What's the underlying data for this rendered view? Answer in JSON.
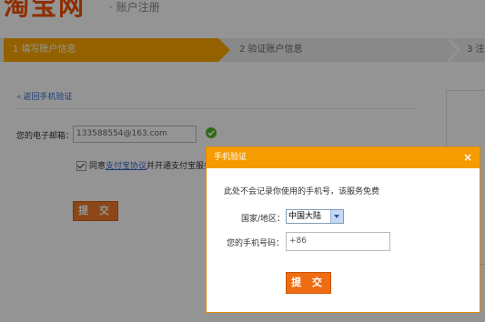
{
  "header": {
    "logo_text": "淘宝网",
    "subtitle": "· 账户注册"
  },
  "steps": [
    {
      "label": "1 填写账户信息",
      "active": true
    },
    {
      "label": "2 验证账户信息",
      "active": false
    },
    {
      "label": "3 注",
      "active": false
    }
  ],
  "form": {
    "back_link": "返回手机验证",
    "email_label": "您的电子邮箱：",
    "email_value": "133588554@163.com",
    "agree_prefix": "同意",
    "agree_link": "支付宝协议",
    "agree_suffix": "并开通支付宝服务",
    "submit_label": "提 交"
  },
  "dialog": {
    "title": "手机验证",
    "close_symbol": "×",
    "note": "此处不会记录你使用的手机号，该服务免费",
    "region_label": "国家/地区：",
    "region_value": "中国大陆",
    "phone_label": "您的手机号码：",
    "phone_value": "+86",
    "submit_label": "提 交"
  },
  "colors": {
    "brand": "#f55000",
    "active_step": "#ffa800",
    "dialog_header": "#f59c00",
    "button": "#ef6c12",
    "link": "#3366cc"
  }
}
